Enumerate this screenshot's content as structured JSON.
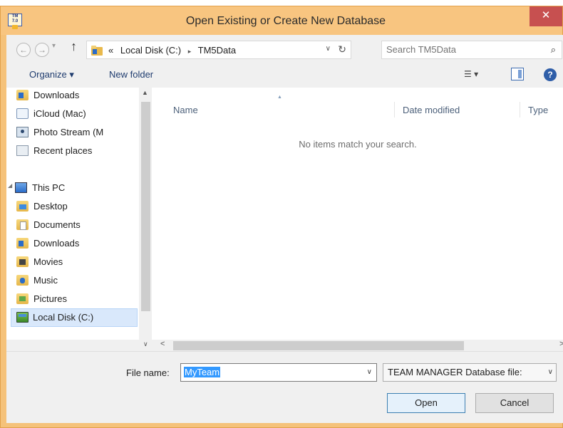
{
  "window": {
    "title": "Open Existing or Create New Database",
    "app_icon_text": "TM 7.0",
    "close_glyph": "✕"
  },
  "nav": {
    "back_glyph": "←",
    "forward_glyph": "→",
    "history_drop": "▾",
    "up_glyph": "↑",
    "breadcrumb_prefix": "«",
    "breadcrumbs": [
      "Local Disk (C:)",
      "TM5Data"
    ],
    "crumb_sep": "▸",
    "address_drop": "∨",
    "refresh_glyph": "↻",
    "search_placeholder": "Search TM5Data",
    "search_glyph": "⌕"
  },
  "toolbar": {
    "organize_label": "Organize ▾",
    "new_folder_label": "New folder",
    "view_glyph": "☰ ▾",
    "help_glyph": "?"
  },
  "sidebar": {
    "scroll_up": "▲",
    "this_pc_label": "This PC",
    "items": [
      {
        "label": "Downloads",
        "icon": "downloads-folder-icon"
      },
      {
        "label": "iCloud (Mac)",
        "icon": "icloud-icon"
      },
      {
        "label": "Photo Stream (M",
        "icon": "photo-stream-icon"
      },
      {
        "label": "Recent places",
        "icon": "recent-places-icon"
      }
    ],
    "pc_items": [
      {
        "label": "Desktop",
        "icon": "desktop-folder-icon"
      },
      {
        "label": "Documents",
        "icon": "documents-folder-icon"
      },
      {
        "label": "Downloads",
        "icon": "downloads-folder-icon"
      },
      {
        "label": "Movies",
        "icon": "movies-folder-icon"
      },
      {
        "label": "Music",
        "icon": "music-folder-icon"
      },
      {
        "label": "Pictures",
        "icon": "pictures-folder-icon"
      },
      {
        "label": "Local Disk (C:)",
        "icon": "local-disk-icon",
        "selected": true
      }
    ]
  },
  "files": {
    "columns": [
      "Name",
      "Date modified",
      "Type"
    ],
    "sort_glyph": "▲",
    "empty_message": "No items match your search."
  },
  "scrollbar": {
    "down_glyph": "∨",
    "left_glyph": "<",
    "right_glyph": ">"
  },
  "footer": {
    "file_name_label": "File name:",
    "file_name_value": "MyTeam",
    "file_type_value": "TEAM MANAGER Database file: ",
    "drop_glyph": "∨",
    "open_label": "Open",
    "cancel_label": "Cancel"
  }
}
